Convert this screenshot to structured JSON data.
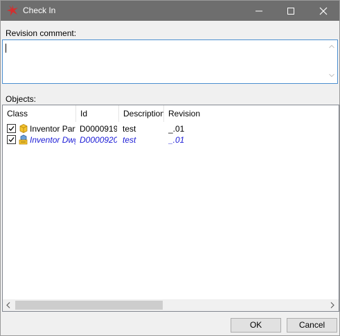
{
  "window": {
    "title": "Check In",
    "icon": "red-star-app-icon",
    "controls": {
      "minimize_icon": "minimize-icon",
      "maximize_icon": "maximize-icon",
      "close_icon": "close-icon"
    }
  },
  "revision": {
    "label": "Revision comment:",
    "value": ""
  },
  "objects": {
    "label": "Objects:",
    "columns": [
      "Class",
      "Id",
      "Description",
      "Revision"
    ],
    "rows": [
      {
        "checked": true,
        "icon": "inventor-part-icon",
        "class": "Inventor Part",
        "id": "D0000919",
        "description": "test",
        "revision": "_.01",
        "style": "normal"
      },
      {
        "checked": true,
        "icon": "inventor-drawing-icon",
        "class": "Inventor Dwg",
        "id": "D0000920",
        "description": "test",
        "revision": "_.01",
        "style": "italic-blue"
      }
    ]
  },
  "buttons": {
    "ok": "OK",
    "cancel": "Cancel"
  },
  "colors": {
    "titlebar": "#6e6e6e",
    "accent_border": "#4a8fd0",
    "linked_row_text": "#1a1ad6",
    "app_icon": "#d32f2f"
  }
}
